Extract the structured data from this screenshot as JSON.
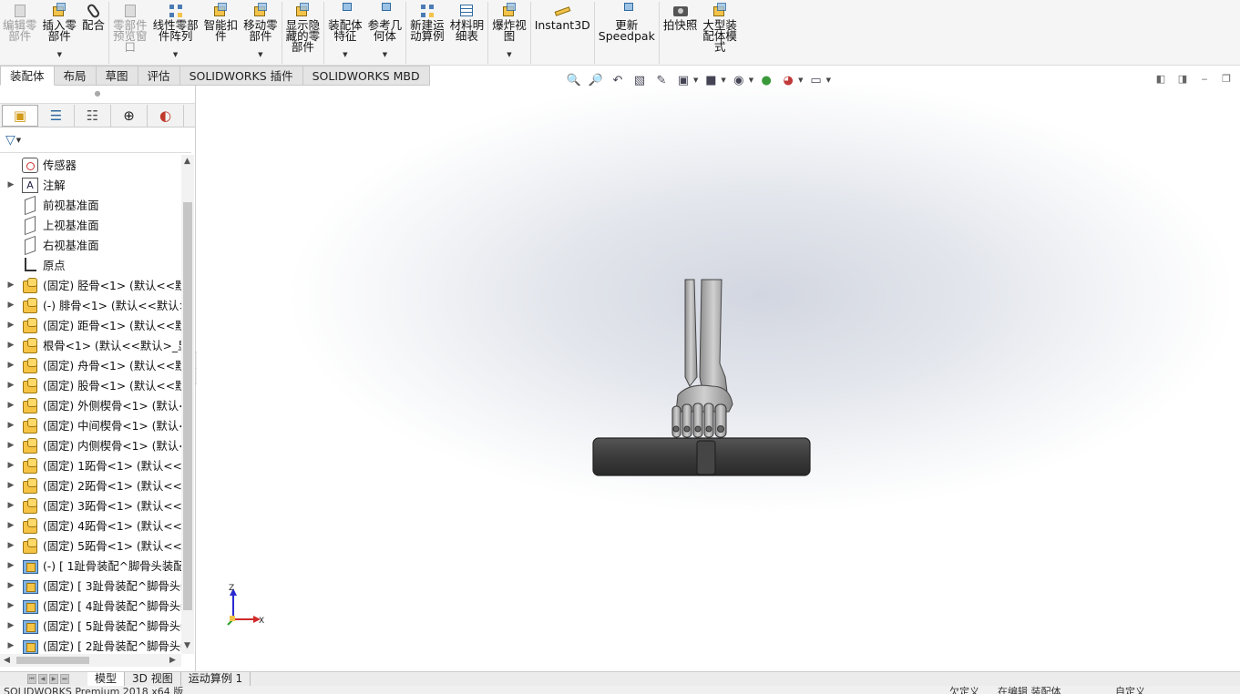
{
  "ribbon": {
    "buttons": [
      {
        "label": "编辑零\n部件",
        "disabled": true
      },
      {
        "label": "插入零\n部件",
        "dropdown": true
      },
      {
        "label": "配合"
      },
      {
        "label": "零部件\n预览窗\n口",
        "disabled": true
      },
      {
        "label": "线性零部\n件阵列",
        "dropdown": true
      },
      {
        "label": "智能扣\n件"
      },
      {
        "label": "移动零\n部件",
        "dropdown": true
      },
      {
        "label": "显示隐\n藏的零\n部件"
      },
      {
        "label": "装配体\n特征",
        "dropdown": true
      },
      {
        "label": "参考几\n何体",
        "dropdown": true
      },
      {
        "label": "新建运\n动算例"
      },
      {
        "label": "材料明\n细表"
      },
      {
        "label": "爆炸视\n图",
        "dropdown": true
      },
      {
        "label": "Instant3D"
      },
      {
        "label": "更新\nSpeedpak"
      },
      {
        "label": "拍快照"
      },
      {
        "label": "大型装\n配体模\n式"
      }
    ]
  },
  "command_tabs": [
    "装配体",
    "布局",
    "草图",
    "评估",
    "SOLIDWORKS 插件",
    "SOLIDWORKS MBD"
  ],
  "active_command_tab": "装配体",
  "feature_tree": {
    "items": [
      {
        "label": "传感器",
        "icon": "sensor-icon",
        "expandable": false
      },
      {
        "label": "注解",
        "icon": "annotation-icon",
        "expandable": true
      },
      {
        "label": "前视基准面",
        "icon": "plane-icon",
        "expandable": false
      },
      {
        "label": "上视基准面",
        "icon": "plane-icon",
        "expandable": false
      },
      {
        "label": "右视基准面",
        "icon": "plane-icon",
        "expandable": false
      },
      {
        "label": "原点",
        "icon": "origin-icon",
        "expandable": false
      },
      {
        "label": "(固定) 胫骨<1> (默认<<默",
        "icon": "part-icon",
        "expandable": true
      },
      {
        "label": "(-) 腓骨<1> (默认<<默认>",
        "icon": "part-icon",
        "expandable": true
      },
      {
        "label": "(固定) 距骨<1> (默认<<默",
        "icon": "part-icon",
        "expandable": true
      },
      {
        "label": "根骨<1> (默认<<默认>_显",
        "icon": "part-icon",
        "expandable": true
      },
      {
        "label": "(固定) 舟骨<1> (默认<<默",
        "icon": "part-icon",
        "expandable": true
      },
      {
        "label": "(固定) 股骨<1> (默认<<默",
        "icon": "part-icon",
        "expandable": true
      },
      {
        "label": "(固定) 外侧楔骨<1> (默认<",
        "icon": "part-icon",
        "expandable": true
      },
      {
        "label": "(固定) 中间楔骨<1> (默认<",
        "icon": "part-icon",
        "expandable": true
      },
      {
        "label": "(固定) 内侧楔骨<1> (默认<",
        "icon": "part-icon",
        "expandable": true
      },
      {
        "label": "(固定) 1跖骨<1> (默认<<默",
        "icon": "part-icon",
        "expandable": true
      },
      {
        "label": "(固定) 2跖骨<1> (默认<<默",
        "icon": "part-icon",
        "expandable": true
      },
      {
        "label": "(固定) 3跖骨<1> (默认<<默",
        "icon": "part-icon",
        "expandable": true
      },
      {
        "label": "(固定) 4跖骨<1> (默认<<默",
        "icon": "part-icon",
        "expandable": true
      },
      {
        "label": "(固定) 5跖骨<1> (默认<<默",
        "icon": "part-icon",
        "expandable": true
      },
      {
        "label": "(-) [ 1趾骨装配^脚骨头装配",
        "icon": "subassembly-icon",
        "expandable": true
      },
      {
        "label": "(固定) [ 3趾骨装配^脚骨头装",
        "icon": "subassembly-icon",
        "expandable": true
      },
      {
        "label": "(固定) [ 4趾骨装配^脚骨头装",
        "icon": "subassembly-icon",
        "expandable": true
      },
      {
        "label": "(固定) [ 5趾骨装配^脚骨头装",
        "icon": "subassembly-icon",
        "expandable": true
      },
      {
        "label": "(固定) [ 2趾骨装配^脚骨头装",
        "icon": "subassembly-icon",
        "expandable": true
      }
    ]
  },
  "triad": {
    "z_label": "Z",
    "x_label": "X"
  },
  "bottom_tabs": [
    "模型",
    "3D 视图",
    "运动算例 1"
  ],
  "active_bottom_tab": "模型",
  "status": {
    "left": "SOLIDWORKS Premium 2018 x64 版",
    "center1": "欠定义",
    "center2": "在编辑 装配体",
    "right": "自定义"
  },
  "colors": {
    "accent": "#2f6aa0",
    "part_yellow": "#f6c445",
    "model_grey": "#9a9a9a",
    "base_dark": "#3c3c3c"
  }
}
